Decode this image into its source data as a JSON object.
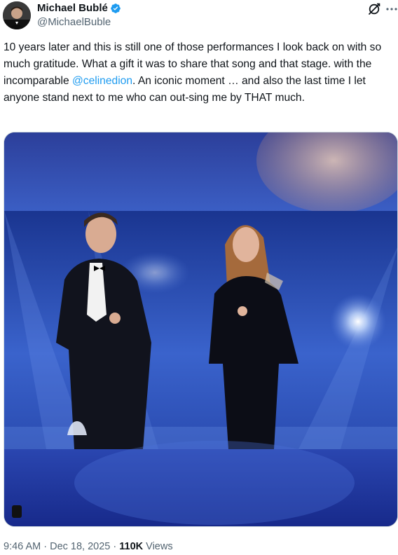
{
  "author": {
    "display_name": "Michael Bublé",
    "handle": "@MichaelBuble",
    "avatar_icon": "profile-photo"
  },
  "tweet": {
    "text_before": "10 years later and this is still one of those performances I look back on with so much gratitude. What a gift it was to share that song and that stage. with the incomparable ",
    "mention": "@celinedion",
    "text_after": ". An iconic moment … and also the last time I let anyone stand next to me who can out-sing me by THAT much."
  },
  "icons": {
    "verified": "verified-badge-icon",
    "grok": "grok-icon",
    "more": "more-options-icon"
  },
  "meta": {
    "time": "9:46 AM",
    "separator": " · ",
    "date": "Dec 18, 2025",
    "views_count": "110K",
    "views_label": " Views"
  },
  "colors": {
    "text": "#0f1419",
    "secondary": "#536471",
    "link": "#1d9bf0",
    "verified": "#1d9bf0"
  }
}
